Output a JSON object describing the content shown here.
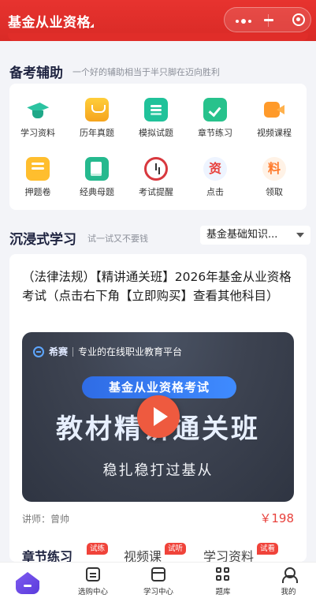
{
  "header": {
    "app_title": "基金从业资格",
    "colors": {
      "brand_red": "#e02d29"
    }
  },
  "aid_section": {
    "title": "备考辅助",
    "subtitle": "一个好的辅助相当于半只脚在迈向胜利",
    "items": [
      {
        "label": "学习资料",
        "icon": "graduation-cap-icon"
      },
      {
        "label": "历年真题",
        "icon": "book-icon"
      },
      {
        "label": "模拟试题",
        "icon": "mock-test-icon"
      },
      {
        "label": "章节练习",
        "icon": "chapter-check-icon"
      },
      {
        "label": "视频课程",
        "icon": "video-camera-icon"
      },
      {
        "label": "押题卷",
        "icon": "test-paper-icon"
      },
      {
        "label": "经典母题",
        "icon": "classic-questions-icon"
      },
      {
        "label": "考试提醒",
        "icon": "alarm-clock-icon"
      },
      {
        "label": "点击",
        "icon": "zi-glyph-icon",
        "glyph": "资"
      },
      {
        "label": "领取",
        "icon": "liao-glyph-icon",
        "glyph": "料"
      }
    ]
  },
  "immersive_section": {
    "title": "沉浸式学习",
    "subtitle": "试一试又不要钱",
    "dropdown_value": "基金基础知识..."
  },
  "course": {
    "title": "（法律法规）【精讲通关班】2026年基金从业资格考试（点击右下角【立即购买】查看其他科目）",
    "banner": {
      "brand": "希赛",
      "tagline": "专业的在线职业教育平台",
      "exam_name": "基金从业资格考试",
      "headline": "教材精讲通关班",
      "slogan": "稳扎稳打过基从"
    },
    "teacher": "讲师：曾帅",
    "price": "￥198",
    "tabs": [
      {
        "label": "章节练习",
        "tag": "试练"
      },
      {
        "label": "视频课",
        "tag": "试听"
      },
      {
        "label": "学习资料",
        "tag": "试看"
      }
    ]
  },
  "bottom_nav": [
    {
      "label": "",
      "icon": "home-icon"
    },
    {
      "label": "选购中心",
      "icon": "cart-icon"
    },
    {
      "label": "学习中心",
      "icon": "study-card-icon"
    },
    {
      "label": "题库",
      "icon": "grid-icon"
    },
    {
      "label": "我的",
      "icon": "user-icon"
    }
  ]
}
